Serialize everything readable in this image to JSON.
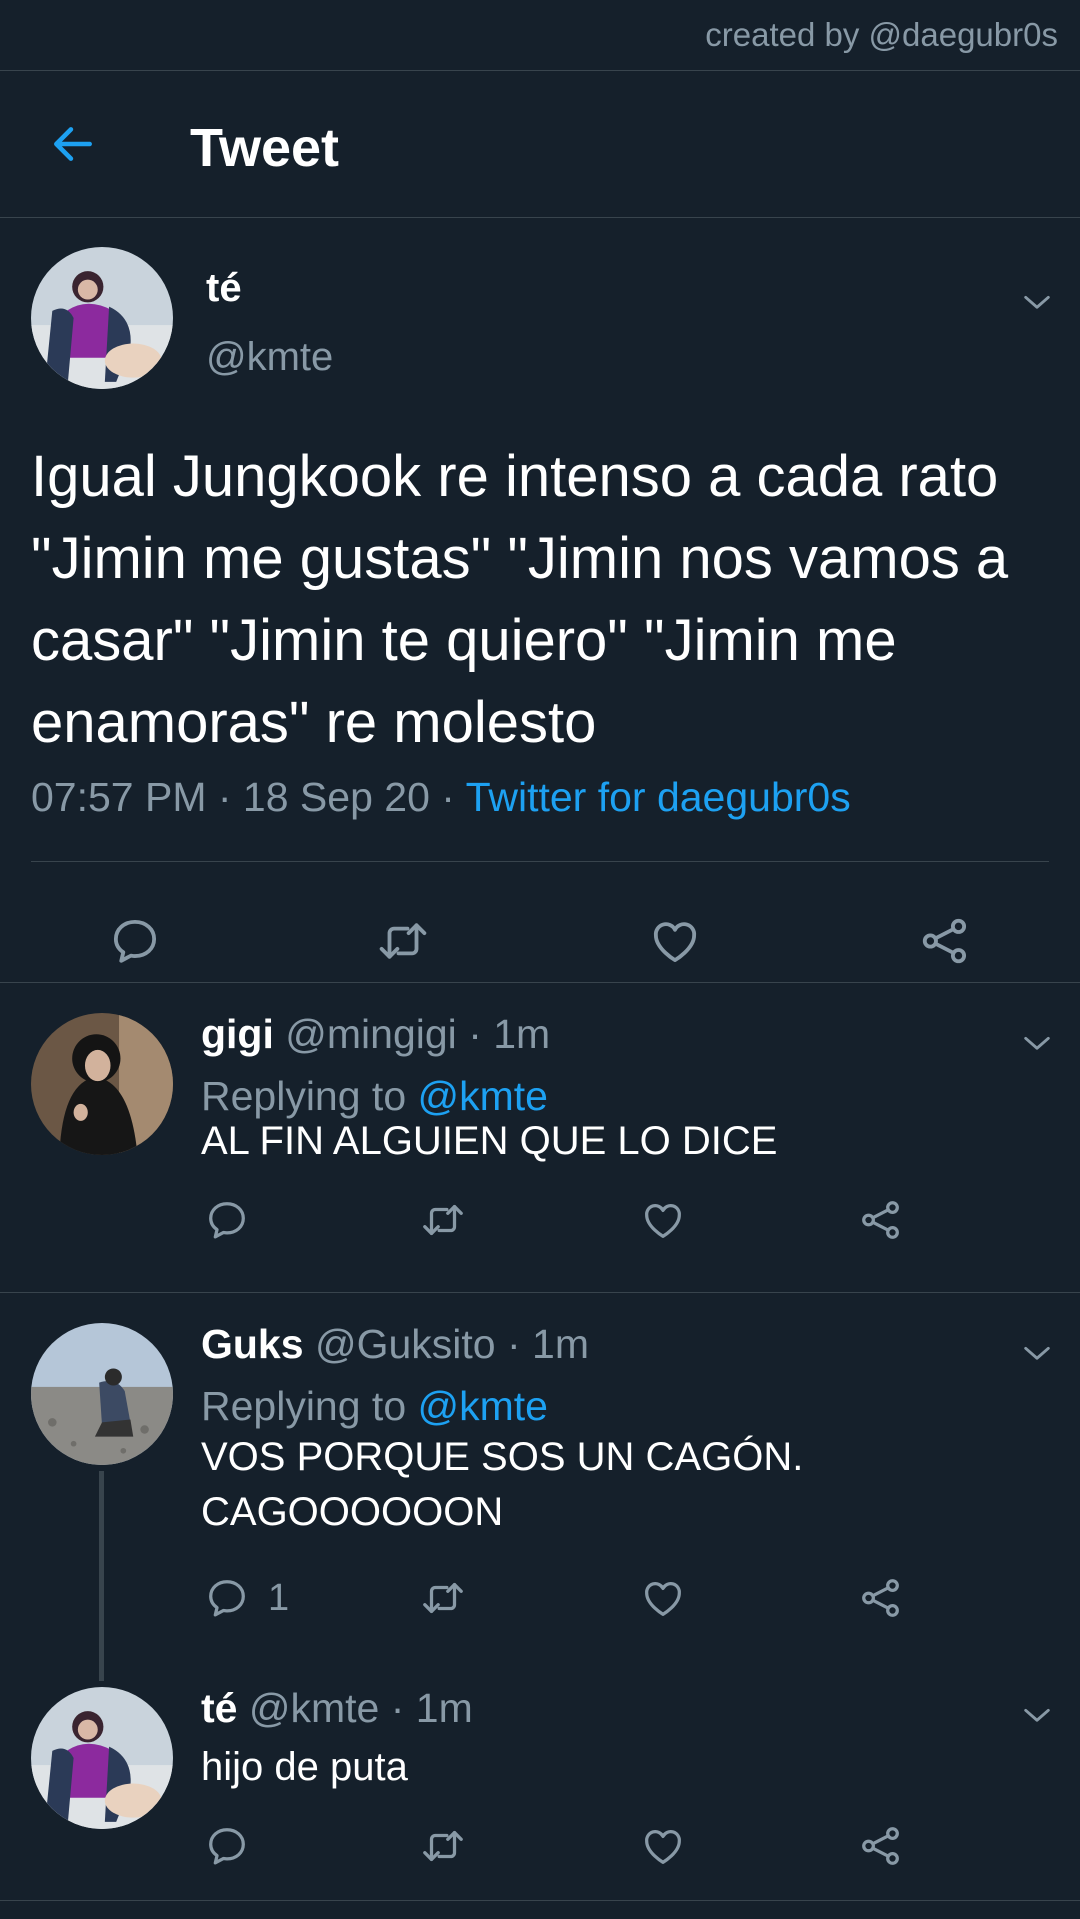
{
  "watermark": "created by @daegubr0s",
  "header": {
    "title": "Tweet",
    "back_icon": "arrow-left-icon"
  },
  "colors": {
    "background": "#15202b",
    "accent": "#1da1f2",
    "muted": "#8899a6",
    "divider": "#38444d"
  },
  "tweet": {
    "name": "té",
    "handle": "@kmte",
    "text": "Igual Jungkook re intenso a cada rato \"Jimin me gustas\" \"Jimin nos vamos a casar\" \"Jimin te quiero\" \"Jimin me enamoras\" re molesto",
    "time": "07:57 PM · 18 Sep 20 · ",
    "source": "Twitter for daegubr0s"
  },
  "replies": [
    {
      "name": "gigi",
      "handle": "@mingigi",
      "time": "· 1m",
      "replying_prefix": "Replying to ",
      "replying_to": "@kmte",
      "text": "AL FIN ALGUIEN QUE LO DICE",
      "reply_count": ""
    },
    {
      "name": "Guks",
      "handle": "@Guksito",
      "time": "· 1m",
      "replying_prefix": "Replying to ",
      "replying_to": "@kmte",
      "text": "VOS PORQUE SOS UN CAGÓN.\nCAGOOOOOON",
      "reply_count": "1"
    },
    {
      "name": "té",
      "handle": "@kmte",
      "time": "· 1m",
      "text": "hijo de puta",
      "reply_count": ""
    }
  ]
}
